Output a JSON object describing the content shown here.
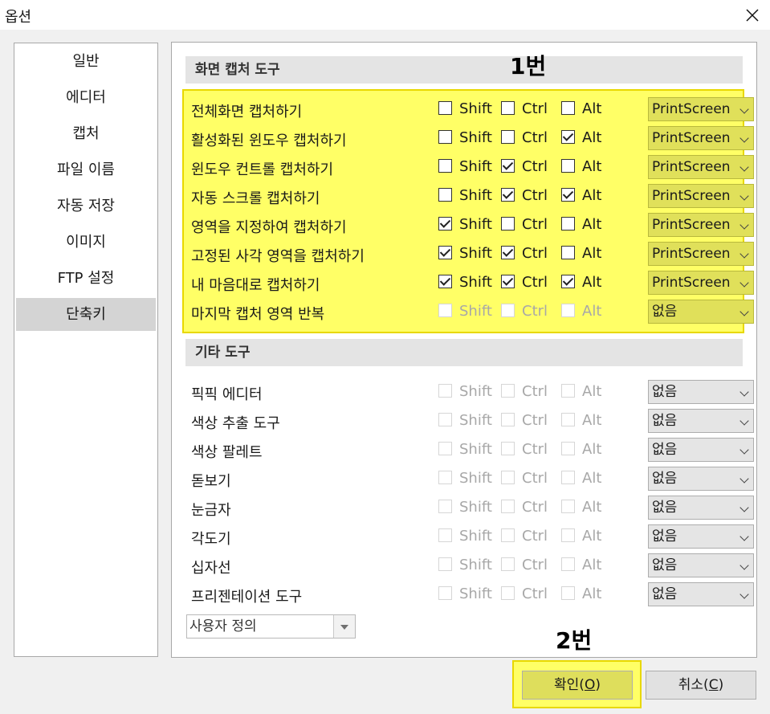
{
  "window": {
    "title": "옵션"
  },
  "sidebar": {
    "items": [
      {
        "label": "일반"
      },
      {
        "label": "에디터"
      },
      {
        "label": "캡처"
      },
      {
        "label": "파일 이름"
      },
      {
        "label": "자동 저장"
      },
      {
        "label": "이미지"
      },
      {
        "label": "FTP 설정"
      },
      {
        "label": "단축키",
        "active": true
      }
    ]
  },
  "sections": {
    "capture": {
      "title": "화면 캡처 도구"
    },
    "other": {
      "title": "기타 도구"
    }
  },
  "modifiers": {
    "shift": "Shift",
    "ctrl": "Ctrl",
    "alt": "Alt"
  },
  "capture_rows": [
    {
      "label": "전체화면 캡처하기",
      "shift": false,
      "ctrl": false,
      "alt": false,
      "key": "PrintScreen",
      "enabled": true
    },
    {
      "label": "활성화된 윈도우 캡처하기",
      "shift": false,
      "ctrl": false,
      "alt": true,
      "key": "PrintScreen",
      "enabled": true
    },
    {
      "label": "윈도우 컨트롤 캡처하기",
      "shift": false,
      "ctrl": true,
      "alt": false,
      "key": "PrintScreen",
      "enabled": true
    },
    {
      "label": "자동 스크롤 캡처하기",
      "shift": false,
      "ctrl": true,
      "alt": true,
      "key": "PrintScreen",
      "enabled": true
    },
    {
      "label": "영역을 지정하여 캡처하기",
      "shift": true,
      "ctrl": false,
      "alt": false,
      "key": "PrintScreen",
      "enabled": true
    },
    {
      "label": "고정된 사각 영역을 캡처하기",
      "shift": true,
      "ctrl": true,
      "alt": false,
      "key": "PrintScreen",
      "enabled": true
    },
    {
      "label": "내 마음대로 캡처하기",
      "shift": true,
      "ctrl": true,
      "alt": true,
      "key": "PrintScreen",
      "enabled": true
    },
    {
      "label": "마지막 캡처 영역 반복",
      "shift": false,
      "ctrl": false,
      "alt": false,
      "key": "없음",
      "enabled": false
    }
  ],
  "other_rows": [
    {
      "label": "픽픽 에디터",
      "key": "없음"
    },
    {
      "label": "색상 추출 도구",
      "key": "없음"
    },
    {
      "label": "색상 팔레트",
      "key": "없음"
    },
    {
      "label": "돋보기",
      "key": "없음"
    },
    {
      "label": "눈금자",
      "key": "없음"
    },
    {
      "label": "각도기",
      "key": "없음"
    },
    {
      "label": "십자선",
      "key": "없음"
    },
    {
      "label": "프리젠테이션 도구",
      "key": "없음"
    }
  ],
  "preset": {
    "value": "사용자 정의"
  },
  "annotations": {
    "first": "1번",
    "second": "2번"
  },
  "buttons": {
    "ok": {
      "label": "확인(",
      "mnemonic": "O",
      "suffix": ")"
    },
    "cancel": {
      "label": "취소(",
      "mnemonic": "C",
      "suffix": ")"
    }
  },
  "colors": {
    "highlight": "#ffff66",
    "highlight_border": "#e8d800",
    "active_sidebar": "#d4d4d4"
  }
}
